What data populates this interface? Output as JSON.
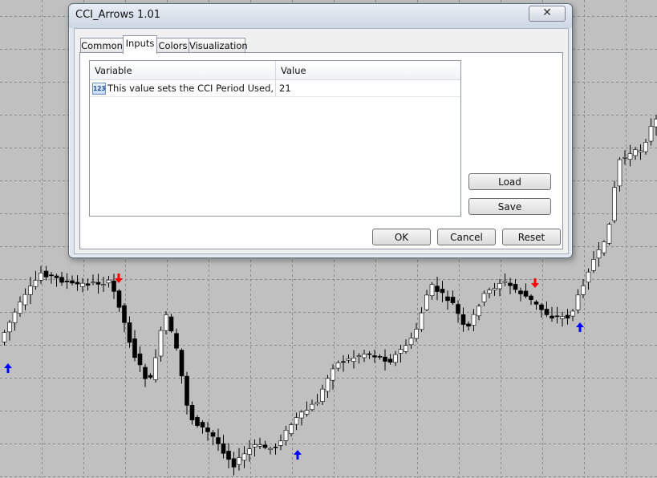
{
  "dialog": {
    "title": "CCI_Arrows 1.01",
    "close_label": "✕",
    "tabs": [
      {
        "label": "Common"
      },
      {
        "label": "Inputs"
      },
      {
        "label": "Colors"
      },
      {
        "label": "Visualization"
      }
    ],
    "active_tab": "Inputs",
    "table": {
      "headers": {
        "variable": "Variable",
        "value": "Value"
      },
      "rows": [
        {
          "icon": "integer-type-icon",
          "icon_text": "123",
          "variable": "This value sets the CCI Period Used, The...",
          "value": "21"
        }
      ]
    },
    "buttons": {
      "load": "Load",
      "save": "Save",
      "ok": "OK",
      "cancel": "Cancel",
      "reset": "Reset"
    }
  },
  "chart_data": {
    "type": "candlestick",
    "background": "#c0c0c0",
    "up_color": "#ffffff",
    "down_color": "#000000",
    "buy_arrow_color": "#0000ff",
    "sell_arrow_color": "#ff0000",
    "grid": true
  }
}
